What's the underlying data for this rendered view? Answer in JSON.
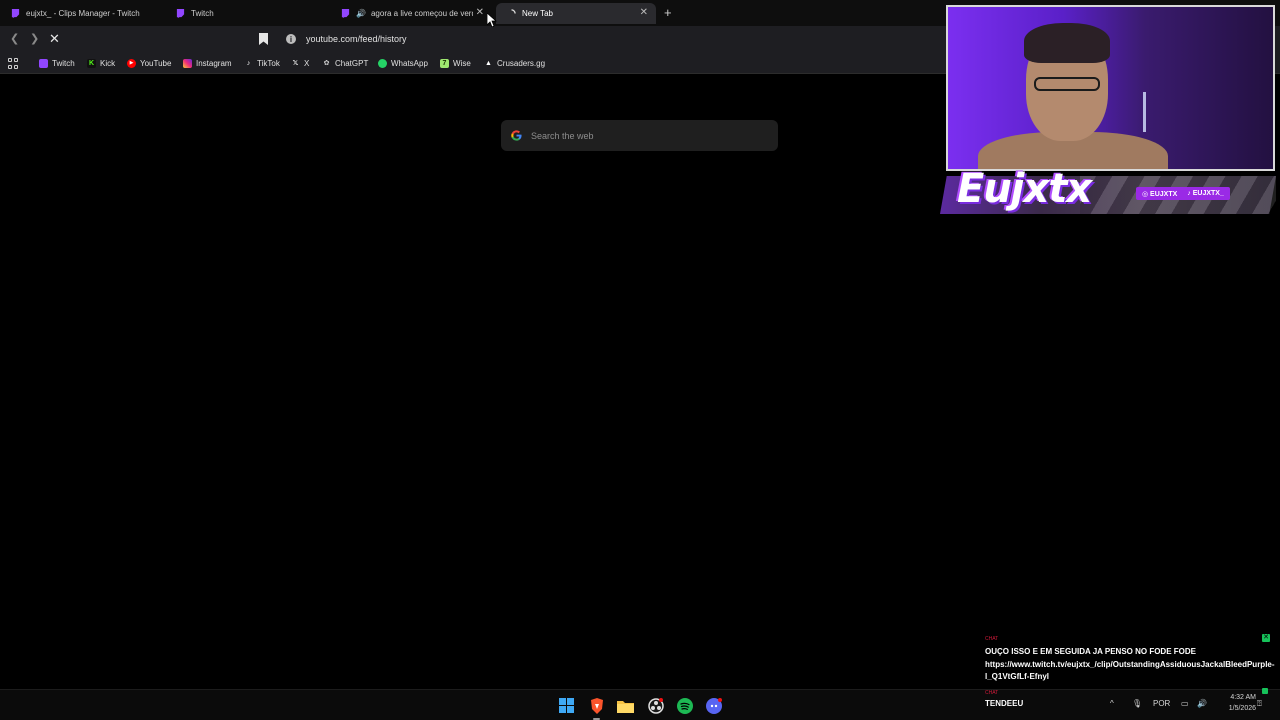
{
  "browser": {
    "tabs": [
      {
        "label": "eujxtx_ - Clips Manager - Twitch",
        "icon": "twitch-icon",
        "active": false
      },
      {
        "label": "Twitch",
        "icon": "twitch-icon",
        "active": false
      },
      {
        "label": "agora a live começou de verdade",
        "icon": "twitch-icon",
        "active": false,
        "playing_audio": true
      },
      {
        "label": "New Tab",
        "icon": "loading-icon",
        "active": true
      }
    ],
    "new_tab_label": "+",
    "close_label": "✕",
    "url": "youtube.com/feed/history",
    "url_info_glyph": "i",
    "bookmarks": [
      {
        "label": "Twitch",
        "icon": "twitch-icon",
        "color": "#9146ff"
      },
      {
        "label": "Kick",
        "icon": "kick-icon",
        "color": "#53fc18"
      },
      {
        "label": "YouTube",
        "icon": "youtube-icon",
        "color": "#ff0000"
      },
      {
        "label": "Instagram",
        "icon": "instagram-icon",
        "color": "#e1306c"
      },
      {
        "label": "TikTok",
        "icon": "tiktok-icon",
        "color": "#ffffff"
      },
      {
        "label": "X",
        "icon": "x-icon",
        "color": "#ffffff"
      },
      {
        "label": "ChatGPT",
        "icon": "chatgpt-icon",
        "color": "#cfcfcf"
      },
      {
        "label": "WhatsApp",
        "icon": "whatsapp-icon",
        "color": "#25d366"
      },
      {
        "label": "Wise",
        "icon": "wise-icon",
        "color": "#9fe870"
      },
      {
        "label": "Crusaders.gg",
        "icon": "crusaders-icon",
        "color": "#ffffff"
      }
    ]
  },
  "page": {
    "search_placeholder": "Search the web"
  },
  "overlay": {
    "streamer_name": "Eujxtx",
    "handles": [
      "◎ EUJXTX",
      "♪ EUJXTX_"
    ],
    "accent": "#9a2ae6"
  },
  "chat": {
    "tag": "CHAT",
    "message": "OUÇO ISSO E EM SEGUIDA JA PENSO NO FODE FODE https://www.twitch.tv/eujxtx_/clip/OutstandingAssiduousJackalBleedPurple-l_Q1VtGfLf-Efnyl",
    "close_label": "✕"
  },
  "taskbar": {
    "apps": [
      "windows-start-icon",
      "brave-browser-icon",
      "file-explorer-icon",
      "obs-studio-icon",
      "spotify-icon",
      "discord-icon"
    ],
    "tray_tag": "CHAT",
    "tray_name": "TENDEEU",
    "tray_chevron": "^",
    "language": "POR",
    "time": "4:32 AM",
    "date": "1/5/2026"
  }
}
